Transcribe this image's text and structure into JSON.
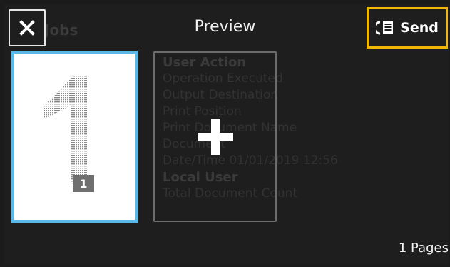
{
  "header": {
    "title": "Preview",
    "close_icon": "close-icon",
    "send_label": "Send",
    "send_icon": "send-document-icon",
    "send_highlight_color": "#f2b705"
  },
  "background": {
    "tab_label": "Jobs",
    "lines": [
      "User Action",
      "Operation Executed",
      "Output Destination",
      "Print Position",
      "Print Document Name",
      "Document",
      "Date/Time                     01/01/2019 12:56",
      "Local User",
      "Total Document Count"
    ]
  },
  "preview": {
    "page_number": "1",
    "selected_border_color": "#5ab8e6",
    "add_icon": "plus-icon"
  },
  "footer": {
    "pages_label": "1 Pages"
  }
}
